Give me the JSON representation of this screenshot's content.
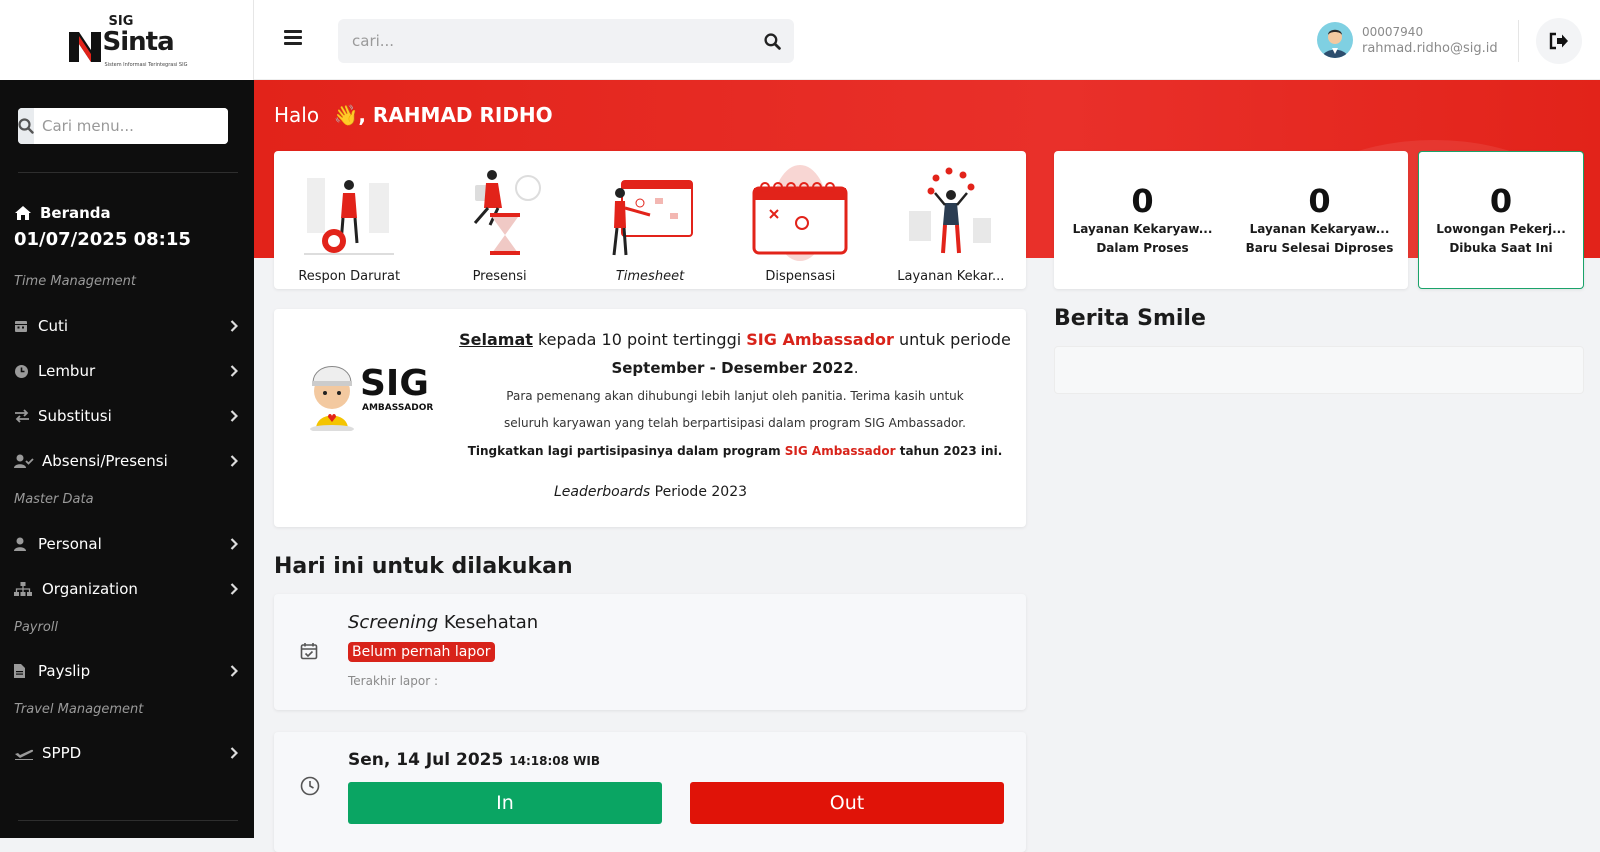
{
  "brand": {
    "top": "SIG",
    "name": "Sinta",
    "tagline": "Sistem Informasi Terintegrasi SIG"
  },
  "sidebar": {
    "search_placeholder": "Cari menu...",
    "home": {
      "label": "Beranda",
      "datetime": "01/07/2025 08:15"
    },
    "sections": {
      "time": "Time Management",
      "master": "Master Data",
      "payroll": "Payroll",
      "travel": "Travel Management"
    },
    "items": {
      "cuti": "Cuti",
      "lembur": "Lembur",
      "substitusi": "Substitusi",
      "absensi": "Absensi/Presensi",
      "personal": "Personal",
      "organization": "Organization",
      "payslip": "Payslip",
      "sppd": "SPPD"
    }
  },
  "topbar": {
    "search_placeholder": "cari...",
    "user_id": "00007940",
    "user_email": "rahmad.ridho@sig.id"
  },
  "greeting": {
    "hello": "Halo",
    "wave": "👋",
    "name": ", RAHMAD RIDHO"
  },
  "quick_menu": [
    {
      "label": "Respon Darurat"
    },
    {
      "label": "Presensi"
    },
    {
      "label": "Timesheet"
    },
    {
      "label": "Dispensasi"
    },
    {
      "label": "Layanan Kekar..."
    }
  ],
  "stats": [
    {
      "value": "0",
      "line1": "Layanan Kekaryaw...",
      "line2": "Dalam Proses"
    },
    {
      "value": "0",
      "line1": "Layanan Kekaryaw...",
      "line2": "Baru Selesai Diproses"
    },
    {
      "value": "0",
      "line1": "Lowongan Pekerj...",
      "line2": "Dibuka Saat Ini"
    }
  ],
  "ambassador": {
    "logo_text": "SIG",
    "logo_sub": "AMBASSADOR",
    "congrats": "Selamat",
    "line1_mid": " kepada 10 point tertinggi ",
    "brand": "SIG Ambassador",
    "line1_end": " untuk periode",
    "period": "September - Desember 2022",
    "period_end": ".",
    "line3": "Para pemenang akan dihubungi lebih lanjut oleh panitia. Terima kasih untuk",
    "line3b": "seluruh karyawan yang telah berpartisipasi dalam program SIG Ambassador.",
    "line4_start": "Tingkatkan lagi partisipasinya dalam program ",
    "line4_brand": "SIG Ambassador",
    "line4_end": " tahun 2023 ini.",
    "lead_italic": "Leaderboards",
    "lead_rest": " Periode 2023"
  },
  "berita": {
    "title": "Berita Smile"
  },
  "todo": {
    "title": "Hari ini untuk dilakukan",
    "screening_italic": "Screening",
    "screening_rest": " Kesehatan",
    "badge": "Belum pernah lapor",
    "last": "Terakhir lapor :"
  },
  "attendance": {
    "date": "Sen, 14 Jul 2025",
    "time": "14:18:08 WIB",
    "in_label": "In",
    "out_label": "Out"
  },
  "colors": {
    "brand_red": "#e2231a",
    "in_green": "#0aa563",
    "out_red": "#e01308",
    "sidebar_bg": "#0e0e0e"
  }
}
